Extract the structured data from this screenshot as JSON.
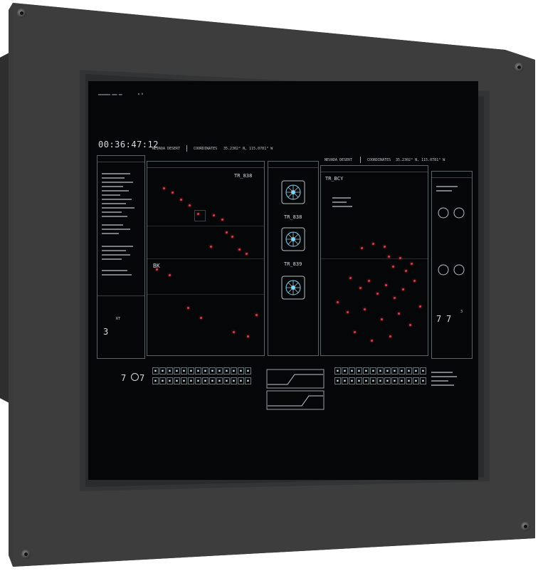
{
  "colors": {
    "bezel": "#3a3a3a",
    "screen": "#050607",
    "alert": "#ff2f3a",
    "accent": "#7fd8ff"
  },
  "header": {
    "time": "00:36:47:12",
    "location_left": "NEVADA DESERT",
    "coords_label_left": "COORDINATES",
    "coords_left": "35.2302° N, 115.0781° W",
    "location_right": "NEVADA DESERT",
    "coords_label_right": "COORDINATES",
    "coords_right": "35.2302° N, 115.0781° W"
  },
  "left_panel": {
    "big_number": "3",
    "label": "RT"
  },
  "map_left": {
    "title": "TR_838",
    "label_bk": "BK"
  },
  "center_units": [
    {
      "label": "TR_838"
    },
    {
      "label": "TR_839"
    }
  ],
  "map_right": {
    "title": "TR_BCY"
  },
  "right_panel": {
    "values": [
      "7",
      "7",
      "3"
    ]
  },
  "bottom": {
    "left_value_a": "7",
    "left_value_b": "7"
  }
}
